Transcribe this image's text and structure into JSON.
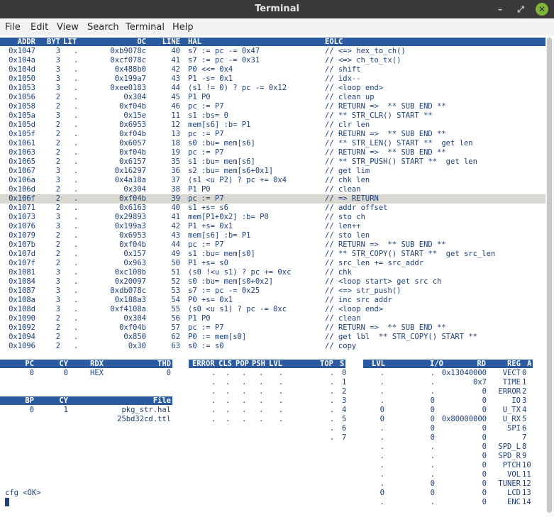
{
  "window": {
    "title": "Terminal"
  },
  "menu": [
    "File",
    "Edit",
    "View",
    "Search",
    "Terminal",
    "Help"
  ],
  "code_table": {
    "headers": {
      "addr": "ADDR",
      "byt": "BYT",
      "lit": "LIT",
      "oc": "OC",
      "line": "LINE",
      "hal": "HAL",
      "eolc": "EOLC"
    },
    "selected_addr": "0x106f",
    "rows": [
      {
        "addr": "0x1047",
        "byt": "3",
        "lit": ".",
        "oc": "0xb9078c",
        "line": "40",
        "hal": "s7 := pc -= 0x47",
        "eolc": "// <=> hex_to_ch()"
      },
      {
        "addr": "0x104a",
        "byt": "3",
        "lit": ".",
        "oc": "0xcf078c",
        "line": "41",
        "hal": "s7 := pc -= 0x31",
        "eolc": "// <=> ch_to_tx()"
      },
      {
        "addr": "0x104d",
        "byt": "3",
        "lit": ".",
        "oc": "0x488b0",
        "line": "42",
        "hal": "P0 <<= 0x4",
        "eolc": "// shift"
      },
      {
        "addr": "0x1050",
        "byt": "3",
        "lit": ".",
        "oc": "0x199a7",
        "line": "43",
        "hal": "P1 -s= 0x1",
        "eolc": "// idx--"
      },
      {
        "addr": "0x1053",
        "byt": "3",
        "lit": ".",
        "oc": "0xee0183",
        "line": "44",
        "hal": "(s1 != 0) ? pc -= 0x12",
        "eolc": "// <loop end>"
      },
      {
        "addr": "0x1056",
        "byt": "2",
        "lit": ".",
        "oc": "0x304",
        "line": "45",
        "hal": "P1 P0",
        "eolc": "// clean up"
      },
      {
        "addr": "0x1058",
        "byt": "2",
        "lit": ".",
        "oc": "0xf04b",
        "line": "46",
        "hal": "pc := P7",
        "eolc": "// RETURN =>  ** SUB END **"
      },
      {
        "addr": "0x105a",
        "byt": "3",
        "lit": ".",
        "oc": "0x15e",
        "line": "11",
        "hal": "s1 :bs= 0",
        "eolc": "// ** STR_CLR() START **"
      },
      {
        "addr": "0x105d",
        "byt": "2",
        "lit": ".",
        "oc": "0x6953",
        "line": "12",
        "hal": "mem[s6] :b= P1",
        "eolc": "// clr len"
      },
      {
        "addr": "0x105f",
        "byt": "2",
        "lit": ".",
        "oc": "0xf04b",
        "line": "13",
        "hal": "pc := P7",
        "eolc": "// RETURN =>  ** SUB END **"
      },
      {
        "addr": "0x1061",
        "byt": "2",
        "lit": ".",
        "oc": "0x6057",
        "line": "18",
        "hal": "s0 :bu= mem[s6]",
        "eolc": "// ** STR_LEN() START **  get len"
      },
      {
        "addr": "0x1063",
        "byt": "2",
        "lit": ".",
        "oc": "0xf04b",
        "line": "19",
        "hal": "pc := P7",
        "eolc": "// RETURN =>  ** SUB END **"
      },
      {
        "addr": "0x1065",
        "byt": "2",
        "lit": ".",
        "oc": "0x6157",
        "line": "35",
        "hal": "s1 :bu= mem[s6]",
        "eolc": "// ** STR_PUSH() START **  get len"
      },
      {
        "addr": "0x1067",
        "byt": "3",
        "lit": ".",
        "oc": "0x16297",
        "line": "36",
        "hal": "s2 :bu= mem[s6+0x1]",
        "eolc": "// get lim"
      },
      {
        "addr": "0x106a",
        "byt": "3",
        "lit": ".",
        "oc": "0x4a18a",
        "line": "37",
        "hal": "(s1 <u P2) ? pc += 0x4",
        "eolc": "// chk len"
      },
      {
        "addr": "0x106d",
        "byt": "2",
        "lit": ".",
        "oc": "0x304",
        "line": "38",
        "hal": "P1 P0",
        "eolc": "// clean"
      },
      {
        "addr": "0x106f",
        "byt": "2",
        "lit": ".",
        "oc": "0xf04b",
        "line": "39",
        "hal": "pc := P7",
        "eolc": "// => RETURN"
      },
      {
        "addr": "0x1071",
        "byt": "2",
        "lit": ".",
        "oc": "0x6163",
        "line": "40",
        "hal": "s1 +s= s6",
        "eolc": "// addr offset"
      },
      {
        "addr": "0x1073",
        "byt": "3",
        "lit": ".",
        "oc": "0x29893",
        "line": "41",
        "hal": "mem[P1+0x2] :b= P0",
        "eolc": "// sto ch"
      },
      {
        "addr": "0x1076",
        "byt": "3",
        "lit": ".",
        "oc": "0x199a3",
        "line": "42",
        "hal": "P1 +s= 0x1",
        "eolc": "// len++"
      },
      {
        "addr": "0x1079",
        "byt": "2",
        "lit": ".",
        "oc": "0x6953",
        "line": "43",
        "hal": "mem[s6] :b= P1",
        "eolc": "// sto len"
      },
      {
        "addr": "0x107b",
        "byt": "2",
        "lit": ".",
        "oc": "0xf04b",
        "line": "44",
        "hal": "pc := P7",
        "eolc": "// RETURN =>  ** SUB END **"
      },
      {
        "addr": "0x107d",
        "byt": "2",
        "lit": ".",
        "oc": "0x157",
        "line": "49",
        "hal": "s1 :bu= mem[s0]",
        "eolc": "// ** STR_COPY() START **  get src_len"
      },
      {
        "addr": "0x107f",
        "byt": "2",
        "lit": ".",
        "oc": "0x963",
        "line": "50",
        "hal": "P1 +s= s0",
        "eolc": "// src_len += src_addr"
      },
      {
        "addr": "0x1081",
        "byt": "3",
        "lit": ".",
        "oc": "0xc108b",
        "line": "51",
        "hal": "(s0 !<u s1) ? pc += 0xc",
        "eolc": "// chk"
      },
      {
        "addr": "0x1084",
        "byt": "3",
        "lit": ".",
        "oc": "0x20097",
        "line": "52",
        "hal": "s0 :bu= mem[s0+0x2]",
        "eolc": "// <loop start> get src ch"
      },
      {
        "addr": "0x1087",
        "byt": "3",
        "lit": ".",
        "oc": "0xdb078c",
        "line": "53",
        "hal": "s7 := pc -= 0x25",
        "eolc": "// <=> str_push()"
      },
      {
        "addr": "0x108a",
        "byt": "3",
        "lit": ".",
        "oc": "0x188a3",
        "line": "54",
        "hal": "P0 +s= 0x1",
        "eolc": "// inc src addr"
      },
      {
        "addr": "0x108d",
        "byt": "3",
        "lit": ".",
        "oc": "0xf4108a",
        "line": "55",
        "hal": "(s0 <u s1) ? pc -= 0xc",
        "eolc": "// <loop end>"
      },
      {
        "addr": "0x1090",
        "byt": "2",
        "lit": ".",
        "oc": "0x304",
        "line": "56",
        "hal": "P1 P0",
        "eolc": "// clean"
      },
      {
        "addr": "0x1092",
        "byt": "2",
        "lit": ".",
        "oc": "0xf04b",
        "line": "57",
        "hal": "pc := P7",
        "eolc": "// RETURN =>  ** SUB END **"
      },
      {
        "addr": "0x1094",
        "byt": "2",
        "lit": ".",
        "oc": "0x850",
        "line": "62",
        "hal": "P0 := mem[s0]",
        "eolc": "// get lbl  ** STR_COPY() START **"
      },
      {
        "addr": "0x1096",
        "byt": "2",
        "lit": ".",
        "oc": "0x30",
        "line": "63",
        "hal": "s0 := s0",
        "eolc": "// copy"
      }
    ]
  },
  "pc_panel": {
    "headers": {
      "pc": "PC",
      "cy": "CY",
      "rdx": "RDX",
      "thd": "THD"
    },
    "pc": "0",
    "cy": "0",
    "rdx": "HEX",
    "thd": "0"
  },
  "bp_panel": {
    "headers": {
      "bp": "BP",
      "cy": "CY",
      "file": "File"
    },
    "bp": "0",
    "cy": "1",
    "files": [
      "pkg_str.hal",
      "25bd32cd.ttl"
    ]
  },
  "stack_panel": {
    "headers": {
      "error": "ERROR",
      "cls": "CLS",
      "pop": "POP",
      "psh": "PSH",
      "lvl": "LVL",
      "top": "TOP",
      "s": "S"
    },
    "rows": [
      {
        "error": ".",
        "cls": ".",
        "pop": ".",
        "psh": ".",
        "lvl": ".",
        "top": ".",
        "s": "0"
      },
      {
        "error": ".",
        "cls": ".",
        "pop": ".",
        "psh": ".",
        "lvl": ".",
        "top": ".",
        "s": "1"
      },
      {
        "error": ".",
        "cls": ".",
        "pop": ".",
        "psh": ".",
        "lvl": ".",
        "top": ".",
        "s": "2"
      },
      {
        "error": ".",
        "cls": ".",
        "pop": ".",
        "psh": ".",
        "lvl": ".",
        "top": ".",
        "s": "3"
      },
      {
        "error": ".",
        "cls": ".",
        "pop": ".",
        "psh": ".",
        "lvl": ".",
        "top": ".",
        "s": "4"
      },
      {
        "error": ".",
        "cls": ".",
        "pop": ".",
        "psh": ".",
        "lvl": ".",
        "top": ".",
        "s": "5"
      },
      {
        "error": "",
        "cls": "",
        "pop": "",
        "psh": "",
        "lvl": "",
        "top": ".",
        "s": "6"
      },
      {
        "error": "",
        "cls": "",
        "pop": "",
        "psh": "",
        "lvl": "",
        "top": ".",
        "s": "7"
      }
    ]
  },
  "reg_panel": {
    "headers": {
      "lvl": "LVL",
      "io": "I/O",
      "rd": "RD",
      "reg": "REG",
      "a": "A"
    },
    "rows": [
      {
        "lvl": ".",
        "io": ".",
        "rd": "0x13040000",
        "reg": "VECT",
        "a": "0"
      },
      {
        "lvl": ".",
        "io": ".",
        "rd": "0x7",
        "reg": "TIME",
        "a": "1"
      },
      {
        "lvl": ".",
        "io": ".",
        "rd": "0",
        "reg": "ERROR",
        "a": "2"
      },
      {
        "lvl": ".",
        "io": "0",
        "rd": "0",
        "reg": "IO",
        "a": "3"
      },
      {
        "lvl": "0",
        "io": "0",
        "rd": "0",
        "reg": "U_TX",
        "a": "4"
      },
      {
        "lvl": "0",
        "io": "0",
        "rd": "0x80000000",
        "reg": "U_RX",
        "a": "5"
      },
      {
        "lvl": ".",
        "io": "0",
        "rd": "0",
        "reg": "SPI",
        "a": "6"
      },
      {
        "lvl": ".",
        "io": "0",
        "rd": "0",
        "reg": "",
        "a": "7"
      },
      {
        "lvl": ".",
        "io": ".",
        "rd": "0",
        "reg": "SPD_L",
        "a": "8"
      },
      {
        "lvl": ".",
        "io": ".",
        "rd": "0",
        "reg": "SPD_R",
        "a": "9"
      },
      {
        "lvl": ".",
        "io": ".",
        "rd": "0",
        "reg": "PTCH",
        "a": "10"
      },
      {
        "lvl": ".",
        "io": ".",
        "rd": "0",
        "reg": "VOL",
        "a": "11"
      },
      {
        "lvl": ".",
        "io": "0",
        "rd": "0",
        "reg": "TUNER",
        "a": "12"
      },
      {
        "lvl": "0",
        "io": "0",
        "rd": "0",
        "reg": "LCD",
        "a": "13"
      },
      {
        "lvl": ".",
        "io": ".",
        "rd": "0",
        "reg": "ENC",
        "a": "14"
      }
    ]
  },
  "status": {
    "text": "cfg <OK>"
  },
  "colors": {
    "header_bg": "#2c5aa0",
    "text": "#20417a",
    "highlight": "#d8d8d0"
  }
}
